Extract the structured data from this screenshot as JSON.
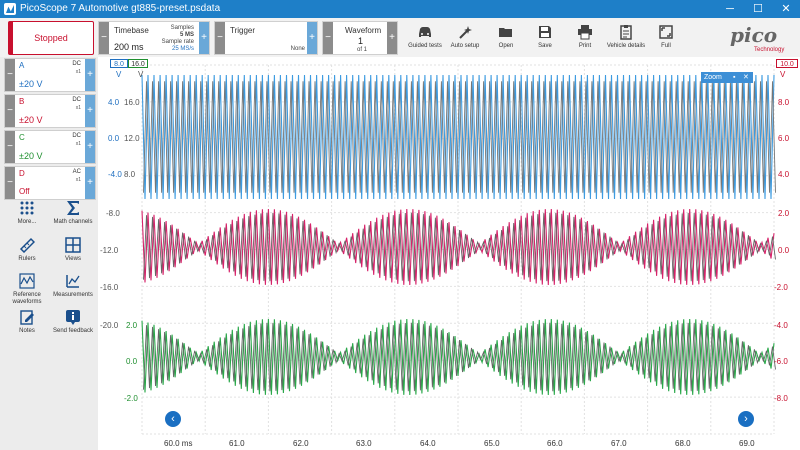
{
  "window": {
    "title": "PicoScope 7 Automotive gt885-preset.psdata",
    "min": "─",
    "max": "☐",
    "close": "✕"
  },
  "toolbar": {
    "run_state": "Stopped",
    "timebase": {
      "label": "Timebase",
      "value": "200 ms"
    },
    "samples": {
      "label": "Samples",
      "value": "5 MS",
      "rate_label": "Sample rate",
      "rate_value": "25 MS/s"
    },
    "trigger": {
      "label": "Trigger",
      "value": "None"
    },
    "waveform": {
      "label": "Waveform",
      "value": "1",
      "of": "of 1"
    },
    "tools": [
      {
        "label": "Guided tests",
        "icon": "car-icon"
      },
      {
        "label": "Auto setup",
        "icon": "wand-icon"
      },
      {
        "label": "Open",
        "icon": "folder-icon"
      },
      {
        "label": "Save",
        "icon": "save-icon"
      },
      {
        "label": "Print",
        "icon": "printer-icon"
      },
      {
        "label": "Vehicle details",
        "icon": "clipboard-icon"
      },
      {
        "label": "Full",
        "icon": "fullscreen-icon"
      }
    ],
    "logo": {
      "brand": "pico",
      "sub": "Technology"
    }
  },
  "channels": [
    {
      "name": "A",
      "coupling": "DC",
      "probe": "x1",
      "range": "±20 V",
      "color": "#1f6fc0"
    },
    {
      "name": "B",
      "coupling": "DC",
      "probe": "x1",
      "range": "±20 V",
      "color": "#c8102e"
    },
    {
      "name": "C",
      "coupling": "DC",
      "probe": "x1",
      "range": "±20 V",
      "color": "#1f8f2f"
    },
    {
      "name": "D",
      "coupling": "AC",
      "probe": "x1",
      "range": "Off",
      "color": "#c8102e"
    }
  ],
  "panel_buttons": [
    {
      "label": "More...",
      "icon": "grid-dots-icon"
    },
    {
      "label": "Math channels",
      "icon": "sigma-icon"
    },
    {
      "label": "Rulers",
      "icon": "ruler-icon"
    },
    {
      "label": "Views",
      "icon": "views-grid-icon"
    },
    {
      "label": "Reference waveforms",
      "icon": "reference-waveform-icon"
    },
    {
      "label": "Measurements",
      "icon": "measurements-icon"
    },
    {
      "label": "Notes",
      "icon": "notes-icon"
    },
    {
      "label": "Send feedback",
      "icon": "info-icon"
    }
  ],
  "scope": {
    "left_tabs": [
      "8.0",
      "16.0"
    ],
    "right_tab": "10.0",
    "unit": "V",
    "zoom_label": "Zoom",
    "left_axis_a": [
      "4.0",
      "0.0",
      "-4.0"
    ],
    "left_axis_a2": [
      "16.0",
      "12.0",
      "8.0"
    ],
    "left_axis_b": [
      "-8.0",
      "-12.0",
      "-16.0"
    ],
    "left_axis_c1": [
      "-20.0"
    ],
    "left_axis_c2": [
      "2.0",
      "0.0",
      "-2.0"
    ],
    "right_axis": [
      "8.0",
      "6.0",
      "4.0",
      "2.0",
      "0.0",
      "-2.0",
      "-4.0",
      "-6.0",
      "-8.0"
    ],
    "time_axis": [
      "60.0 ms",
      "61.0",
      "62.0",
      "63.0",
      "64.0",
      "65.0",
      "66.0",
      "67.0",
      "68.0",
      "69.0"
    ]
  }
}
